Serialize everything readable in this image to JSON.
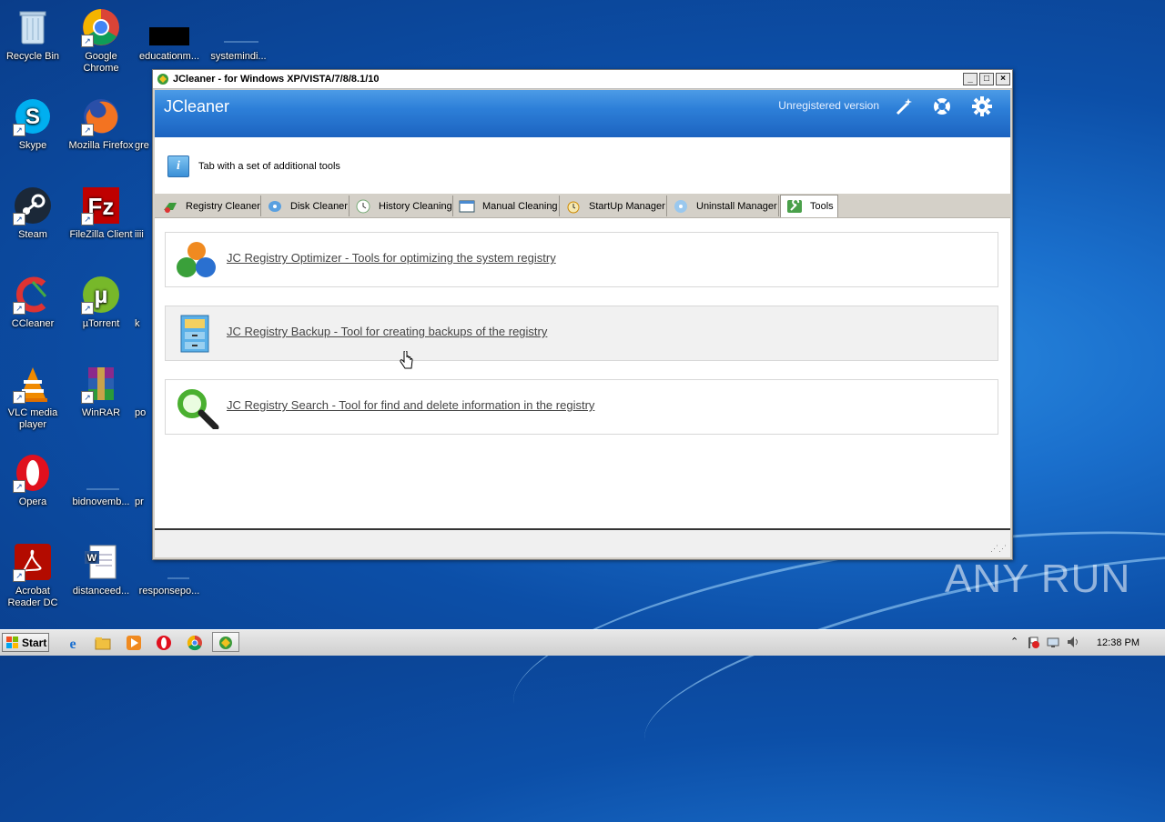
{
  "desktop": {
    "icons": [
      {
        "label": "Recycle Bin"
      },
      {
        "label": "Google Chrome"
      },
      {
        "label": "educationm..."
      },
      {
        "label": "systemindi..."
      },
      {
        "label": "Skype"
      },
      {
        "label": "Mozilla Firefox"
      },
      {
        "label": "gre"
      },
      {
        "label": "Steam"
      },
      {
        "label": "FileZilla Client"
      },
      {
        "label": "iiii"
      },
      {
        "label": "CCleaner"
      },
      {
        "label": "µTorrent"
      },
      {
        "label": "k"
      },
      {
        "label": "VLC media player"
      },
      {
        "label": "WinRAR"
      },
      {
        "label": "po"
      },
      {
        "label": "Opera"
      },
      {
        "label": "bidnovemb..."
      },
      {
        "label": "pr"
      },
      {
        "label": "Acrobat Reader DC"
      },
      {
        "label": "distanceed..."
      },
      {
        "label": "responsepo..."
      }
    ],
    "watermark": "ANY RUN"
  },
  "window": {
    "title": "JCleaner - for Windows XP/VISTA/7/8/8.1/10",
    "controls": {
      "minimize": "_",
      "maximize": "□",
      "close": "×"
    },
    "header": {
      "app_name": "JCleaner",
      "registration": "Unregistered version",
      "icons": [
        "magic-wand-icon",
        "lifebuoy-icon",
        "settings-gear-icon"
      ]
    },
    "info_text": "Tab with a set of additional tools",
    "tabs": [
      {
        "label": "Registry Cleaner",
        "icon": "registry-cleaner-icon"
      },
      {
        "label": "Disk Cleaner",
        "icon": "disk-cleaner-icon"
      },
      {
        "label": "History Cleaning",
        "icon": "history-clock-icon"
      },
      {
        "label": "Manual Cleaning",
        "icon": "window-icon"
      },
      {
        "label": "StartUp Manager",
        "icon": "alarm-clock-icon"
      },
      {
        "label": "Uninstall Manager",
        "icon": "uninstall-disc-icon"
      },
      {
        "label": "Tools",
        "icon": "wrench-icon",
        "active": true
      }
    ],
    "tools": [
      {
        "label": "JC Registry Optimizer - Tools for optimizing the system registry",
        "icon": "colored-balls-icon"
      },
      {
        "label": "JC Registry Backup - Tool for creating backups of the registry",
        "icon": "filing-cabinet-icon"
      },
      {
        "label": "JC Registry Search - Tool for find and delete information in the registry",
        "icon": "magnifier-icon"
      }
    ]
  },
  "taskbar": {
    "start_label": "Start",
    "clock": "12:38 PM",
    "pinned": [
      "ie-icon",
      "explorer-folder-icon",
      "media-player-icon",
      "opera-icon",
      "chrome-icon",
      "jcleaner-icon"
    ]
  },
  "colors": {
    "desktop_blue": "#1a6fcc",
    "header_blue": "#2d7fd8",
    "link_gray": "#444444"
  }
}
